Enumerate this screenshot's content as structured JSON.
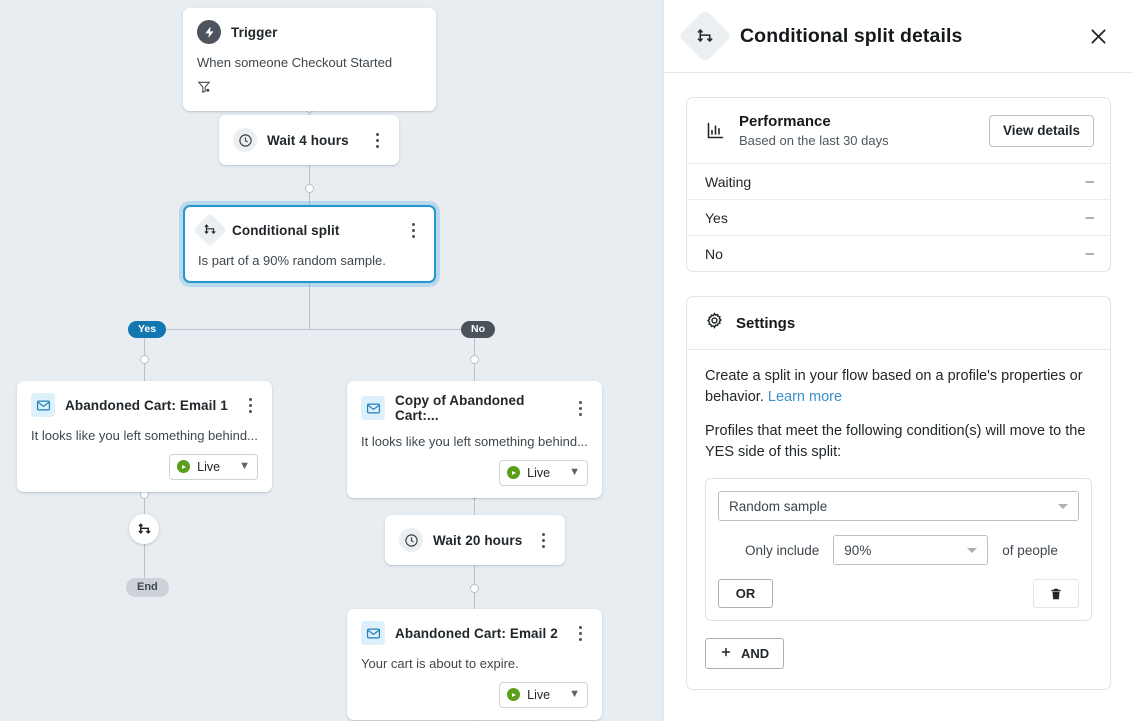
{
  "canvas": {
    "nodes": [
      {
        "id": "trigger",
        "icon": "lightning-icon",
        "title": "Trigger",
        "description": "When someone Checkout Started",
        "badge_icon": "filter-icon"
      },
      {
        "id": "wait-4-hours",
        "icon": "clock-icon",
        "title": "Wait 4 hours"
      },
      {
        "id": "conditional-split",
        "icon": "split-icon",
        "title": "Conditional split",
        "description": "Is part of a 90% random sample.",
        "selected": true
      },
      {
        "id": "abandoned-cart-email-1",
        "icon": "envelope-icon",
        "title": "Abandoned Cart: Email 1",
        "description": "It looks like you left something behind...",
        "status": "Live"
      },
      {
        "id": "copy-of-abandoned-cart",
        "icon": "envelope-icon",
        "title": "Copy of Abandoned Cart:...",
        "description": "It looks like you left something behind...",
        "status": "Live"
      },
      {
        "id": "wait-20-hours",
        "icon": "clock-icon",
        "title": "Wait 20 hours"
      },
      {
        "id": "abandoned-cart-email-2",
        "icon": "envelope-icon",
        "title": "Abandoned Cart: Email 2",
        "description": "Your cart is about to expire.",
        "status": "Live"
      }
    ],
    "branch_labels": {
      "yes": "Yes",
      "no": "No"
    },
    "end_label": "End",
    "colors": {
      "yes_pill": "#1277b0",
      "no_pill": "#4b5258",
      "end_pill": "#ccd2d7",
      "canvas_bg": "#e8edf1",
      "live_dot": "#5a9e1b"
    }
  },
  "panel": {
    "icon": "split-icon",
    "title": "Conditional split details",
    "close_icon": "close-icon",
    "performance": {
      "icon": "bar-chart-icon",
      "title": "Performance",
      "subtitle": "Based on the last 30 days",
      "view_details_label": "View details",
      "metrics": [
        {
          "label": "Waiting",
          "value": "–"
        },
        {
          "label": "Yes",
          "value": "–"
        },
        {
          "label": "No",
          "value": "–"
        }
      ]
    },
    "settings": {
      "icon": "gear-icon",
      "title": "Settings",
      "description_before_link": "Create a split in your flow based on a profile's properties or behavior. ",
      "learn_more_label": "Learn more",
      "instruction": "Profiles that meet the following condition(s) will move to the YES side of this split:",
      "condition": {
        "type_value": "Random sample",
        "only_include_label": "Only include",
        "percent_value": "90%",
        "of_people_label": "of people",
        "or_label": "OR",
        "delete_icon": "trash-icon"
      },
      "and_label": "AND",
      "and_icon": "plus-icon"
    }
  }
}
